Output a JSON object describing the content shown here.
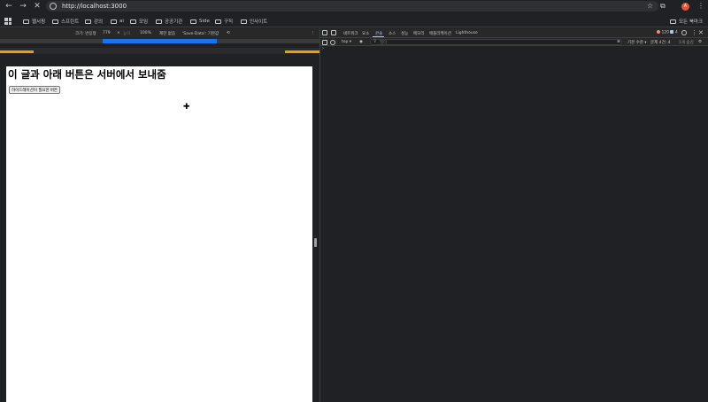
{
  "browser": {
    "url": "http://localhost:3000",
    "avatar_initial": "A",
    "icons": {
      "back": "←",
      "forward": "→",
      "close": "✕",
      "star": "☆",
      "extensions": "⧉",
      "menu": "⋮"
    }
  },
  "bookmarks": {
    "items": [
      "웹서핑",
      "스프린트",
      "강의",
      "ai",
      "모임",
      "공공기관",
      "Side",
      "구직",
      "인사이트"
    ],
    "all_bookmarks": "모든 북마크"
  },
  "device_toolbar": {
    "dimensions_label": "크기: 반응형",
    "width": "779",
    "times": "×",
    "height_placeholder": "높이",
    "zoom": "100%",
    "throttle": "제한 없음",
    "save_data": "'Save-Data': 기본값",
    "more": "⋮"
  },
  "page": {
    "heading": "이 글과 아래 버튼은 서버에서 보내줌",
    "button_label": "하이드레이션이 필요한 버튼",
    "cursor": "✚"
  },
  "devtools": {
    "tabs": [
      "요소",
      "네트워크",
      "요소",
      "콘솔",
      "소스",
      "성능",
      "메모리",
      "애플리케이션",
      "Lighthouse"
    ],
    "active_tab_index": 3,
    "error_count": "120",
    "issue_count": "4",
    "console": {
      "context": "top",
      "filter_placeholder": "필터",
      "level": "기본 수준",
      "issues_label": "문제 4건:",
      "issues_count": "4",
      "hidden_label": "1개 숨김",
      "prompt": "›"
    }
  },
  "colors": {
    "chrome_bg": "#202124",
    "page_bg": "#ffffff",
    "accent": "#a8c7fa",
    "error": "#f28b82",
    "avatar": "#e2533a",
    "media_query": "#1a73e8",
    "breakpoint": "#e5a00d"
  }
}
